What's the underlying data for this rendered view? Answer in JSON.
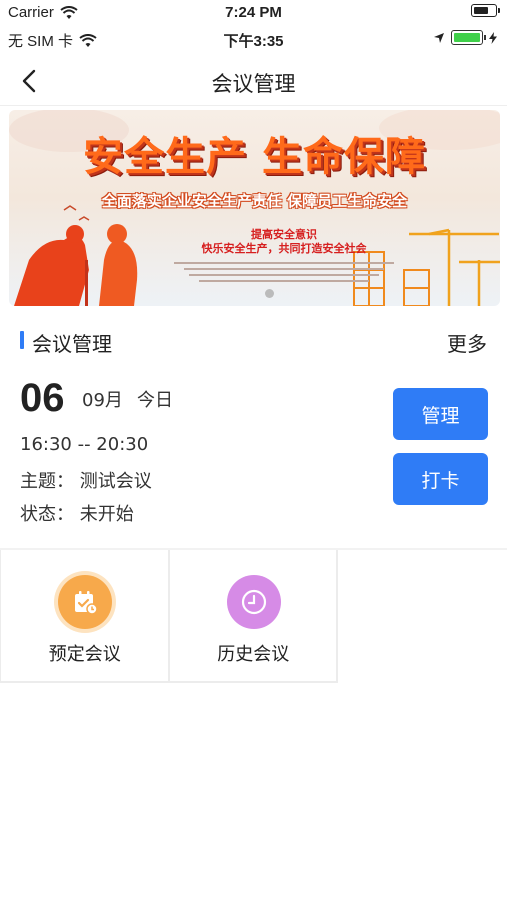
{
  "status_bar": {
    "carrier": "Carrier",
    "time": "7:24 PM",
    "sim": "无 SIM 卡",
    "time2": "下午3:35"
  },
  "navbar": {
    "title": "会议管理"
  },
  "banner": {
    "headline": "安全生产 生命保障",
    "subline": "全面落实企业安全生产责任 保障员工生命安全",
    "line1": "提高安全意识",
    "line2": "快乐安全生产，共同打造安全社会"
  },
  "section": {
    "title": "会议管理",
    "more": "更多"
  },
  "meeting": {
    "day": "06",
    "month": "09月",
    "today": "今日",
    "time": "16:30 -- 20:30",
    "topic": "主题：  测试会议",
    "status": "状态：  未开始",
    "manage_label": "管理",
    "checkin_label": "打卡"
  },
  "grid": {
    "items": [
      {
        "label": "预定会议",
        "icon": "calendar-check-icon",
        "color": "#f7a94b"
      },
      {
        "label": "历史会议",
        "icon": "clock-icon",
        "color": "#d68be6"
      }
    ]
  },
  "colors": {
    "accent": "#2f7cf6"
  }
}
